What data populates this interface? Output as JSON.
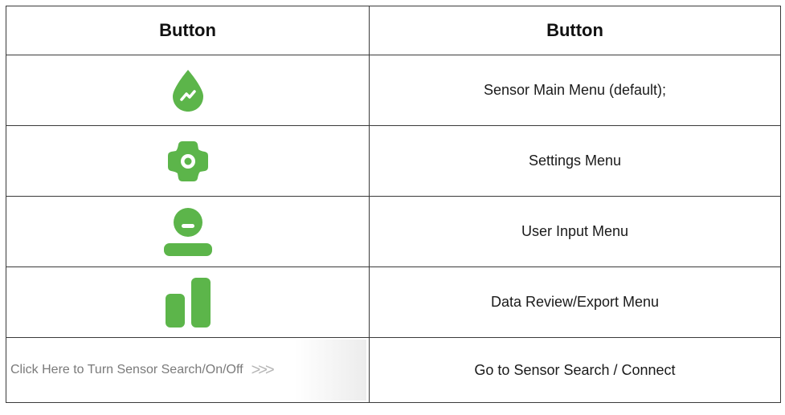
{
  "table": {
    "headers": [
      "Button",
      "Button"
    ],
    "rows": [
      {
        "icon": "sensor-droplet-icon",
        "description": "Sensor Main Menu (default);"
      },
      {
        "icon": "settings-gear-icon",
        "description": "Settings Menu"
      },
      {
        "icon": "user-input-icon",
        "description": "User Input Menu"
      },
      {
        "icon": "data-bar-chart-icon",
        "description": "Data Review/Export Menu"
      },
      {
        "button_label": "Click Here to Turn Sensor Search/On/Off",
        "button_arrows": ">>>",
        "description": "Go to Sensor Search / Connect"
      }
    ]
  },
  "colors": {
    "icon_green": "#5cb54a",
    "border": "#3a3a3a"
  }
}
